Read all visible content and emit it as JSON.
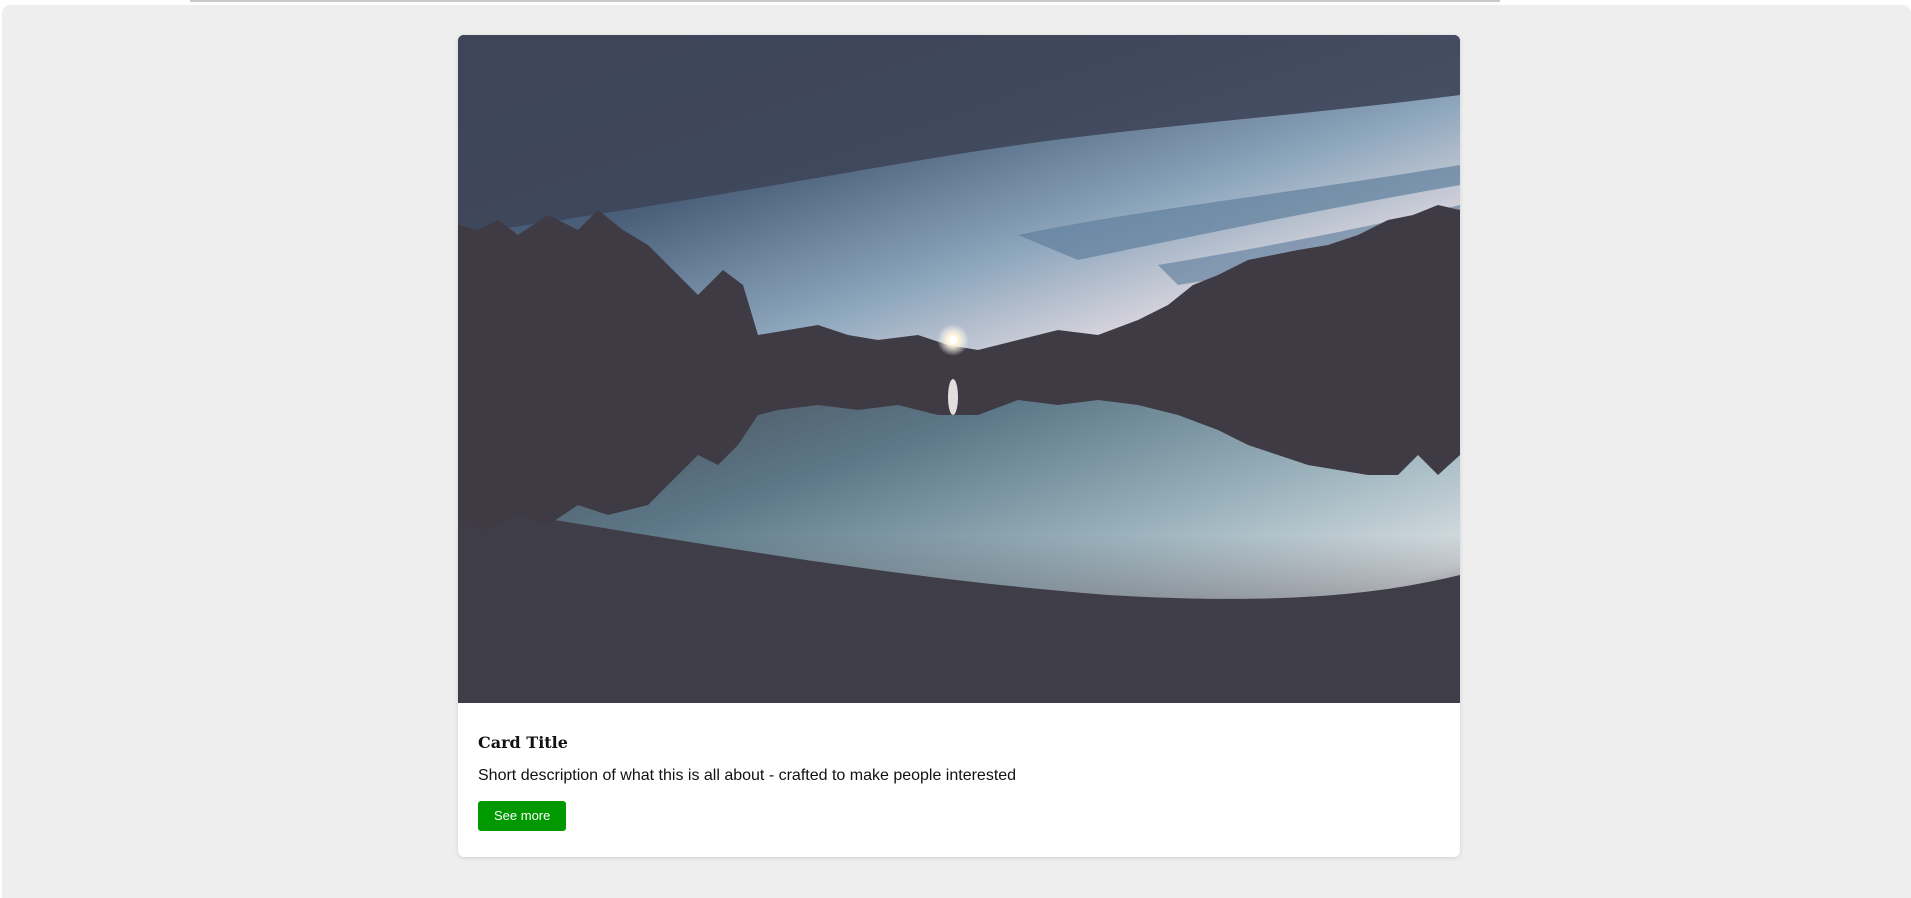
{
  "card": {
    "image_alt": "lake at dusk with trees and reflection",
    "title": "Card Title",
    "description": "Short description of what this is all about - crafted to make people interested",
    "button_label": "See more"
  },
  "colors": {
    "background": "#eeeeee",
    "card": "#ffffff",
    "button": "#009900",
    "button_text": "#ffffff"
  }
}
